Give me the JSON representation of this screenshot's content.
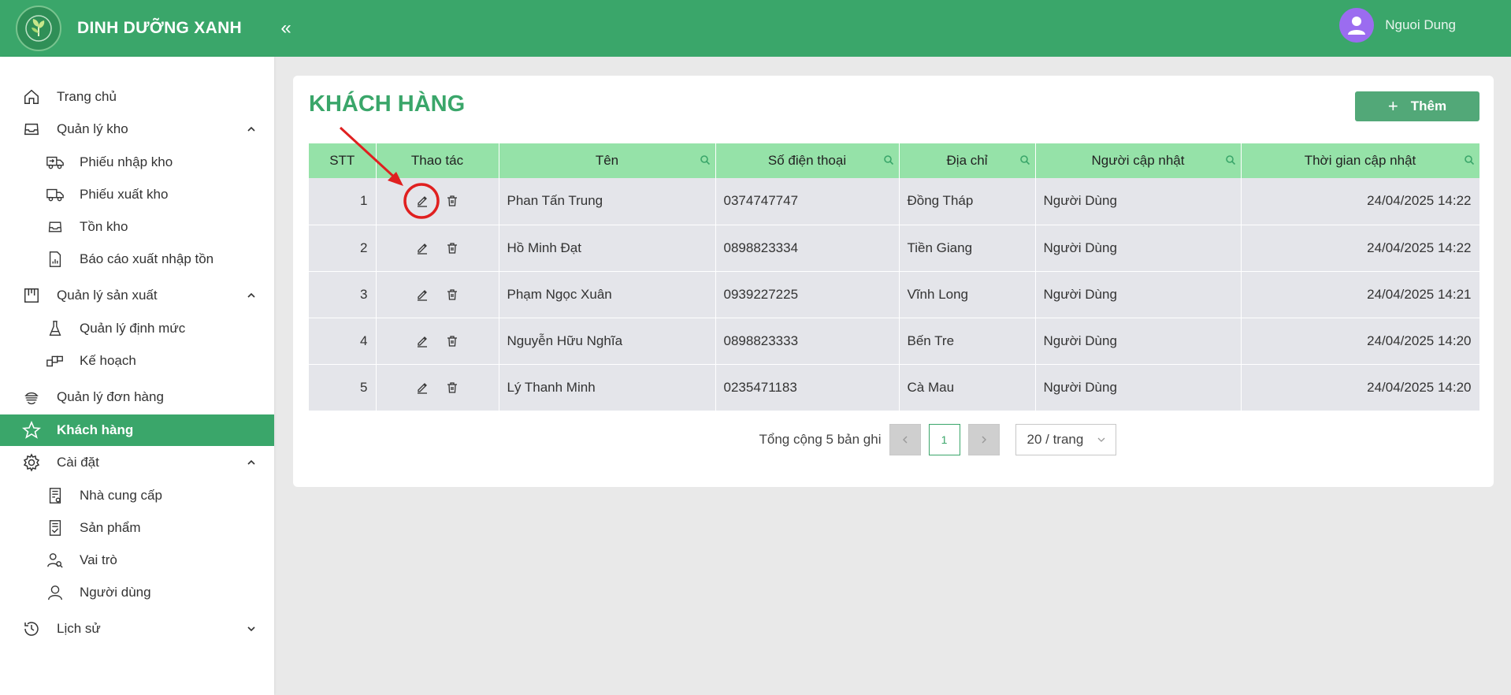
{
  "app": {
    "title": "DINH DƯỠNG XANH",
    "collapse_icon": "«"
  },
  "user": {
    "name": "Nguoi Dung"
  },
  "sidebar": {
    "items": [
      {
        "label": "Trang chủ",
        "icon": "home-icon"
      },
      {
        "label": "Quản lý kho",
        "icon": "inbox-icon"
      },
      {
        "label": "Phiếu nhập kho",
        "icon": "truck-in-icon"
      },
      {
        "label": "Phiếu xuất kho",
        "icon": "truck-out-icon"
      },
      {
        "label": "Tồn kho",
        "icon": "inbox-icon"
      },
      {
        "label": "Báo cáo xuất nhập tồn",
        "icon": "report-icon"
      },
      {
        "label": "Quản lý sản xuất",
        "icon": "factory-icon"
      },
      {
        "label": "Quản lý định mức",
        "icon": "flask-icon"
      },
      {
        "label": "Kế hoạch",
        "icon": "plan-icon"
      },
      {
        "label": "Quản lý đơn hàng",
        "icon": "order-icon"
      },
      {
        "label": "Khách hàng",
        "icon": "star-icon"
      },
      {
        "label": "Cài đặt",
        "icon": "gear-icon"
      },
      {
        "label": "Nhà cung cấp",
        "icon": "supplier-icon"
      },
      {
        "label": "Sản phẩm",
        "icon": "product-icon"
      },
      {
        "label": "Vai trò",
        "icon": "role-icon"
      },
      {
        "label": "Người dùng",
        "icon": "user-icon"
      },
      {
        "label": "Lịch sử",
        "icon": "history-icon"
      }
    ]
  },
  "main": {
    "title": "KHÁCH HÀNG",
    "add_button": "Thêm",
    "table": {
      "headers": [
        "STT",
        "Thao tác",
        "Tên",
        "Số điện thoại",
        "Địa chỉ",
        "Người cập nhật",
        "Thời gian cập nhật"
      ],
      "rows": [
        [
          "1",
          "Phan Tấn Trung",
          "0374747747",
          "Đồng Tháp",
          "Người Dùng",
          "24/04/2025 14:22"
        ],
        [
          "2",
          "Hồ Minh Đạt",
          "0898823334",
          "Tiền Giang",
          "Người Dùng",
          "24/04/2025 14:22"
        ],
        [
          "3",
          "Phạm Ngọc Xuân",
          "0939227225",
          "Vĩnh Long",
          "Người Dùng",
          "24/04/2025 14:21"
        ],
        [
          "4",
          "Nguyễn Hữu Nghĩa",
          "0898823333",
          "Bến Tre",
          "Người Dùng",
          "24/04/2025 14:20"
        ],
        [
          "5",
          "Lý Thanh Minh",
          "0235471183",
          "Cà Mau",
          "Người Dùng",
          "24/04/2025 14:20"
        ]
      ]
    },
    "pagination": {
      "total_text": "Tổng cộng 5 bản ghi",
      "current_page": "1",
      "page_size": "20 / trang"
    }
  },
  "colors": {
    "brand": "#3aa66a",
    "header_row": "#95e2a8",
    "row_bg": "#e4e5ea",
    "annotation": "#e02020"
  }
}
